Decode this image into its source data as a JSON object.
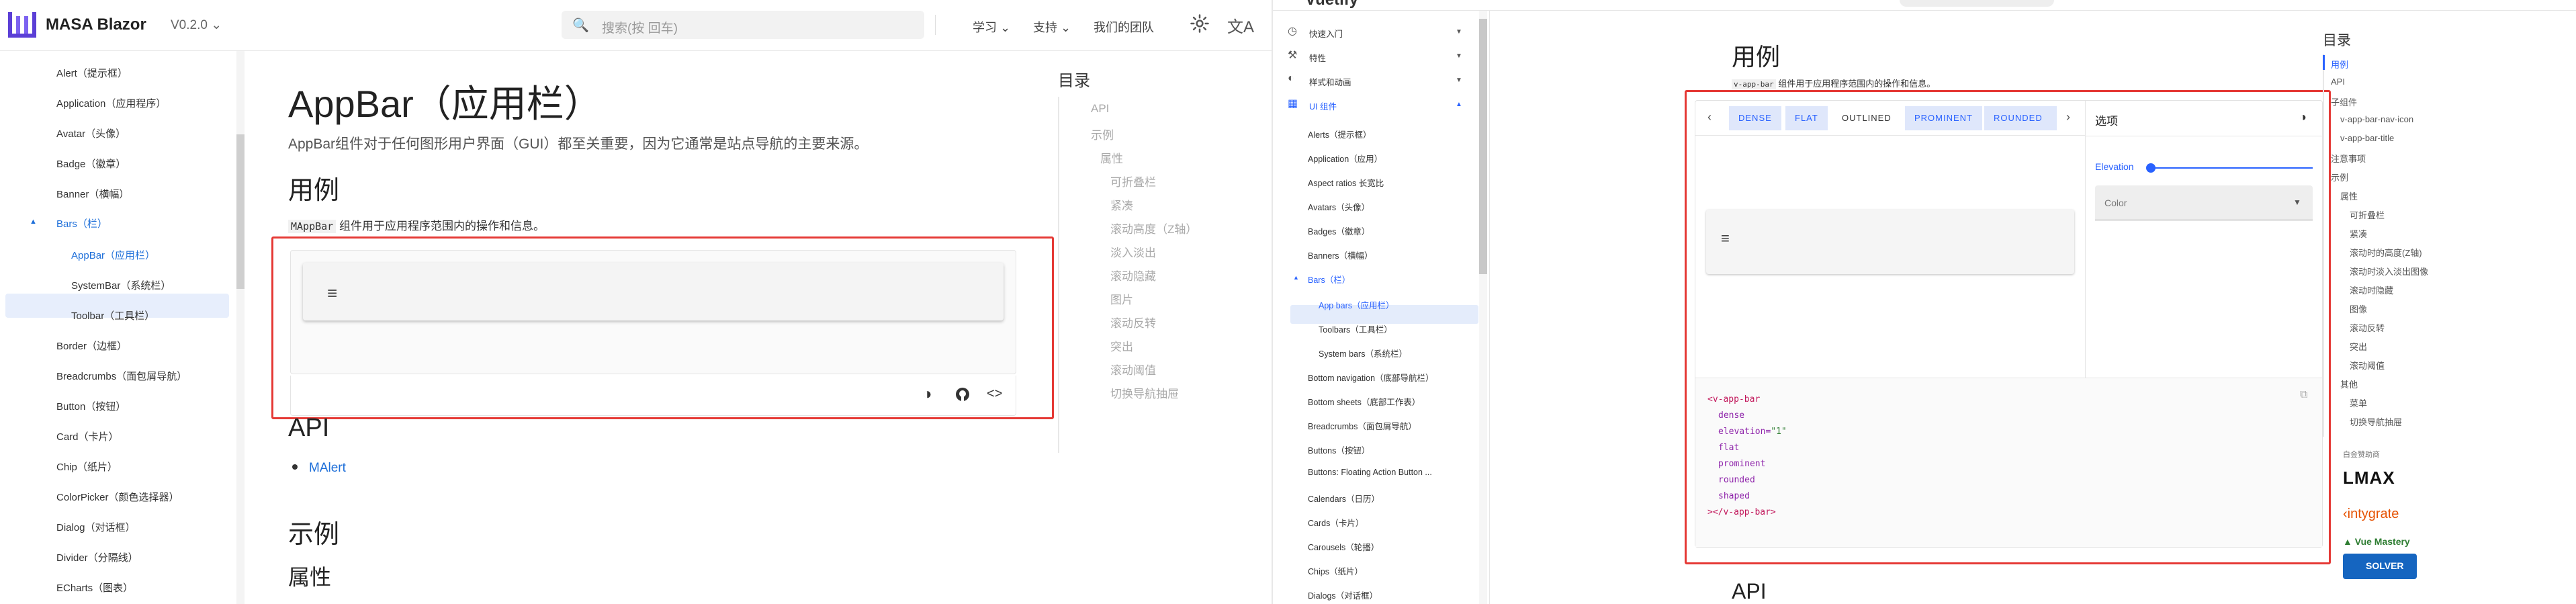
{
  "left": {
    "header": {
      "brand": "MASA Blazor",
      "version": "V0.2.0",
      "search_placeholder": "搜索(按 回车)",
      "nav": [
        "学习",
        "支持",
        "我们的团队"
      ]
    },
    "sidebar": {
      "items": [
        {
          "label": "Alert（提示框）",
          "indent": 1
        },
        {
          "label": "Application（应用程序）",
          "indent": 1
        },
        {
          "label": "Avatar（头像）",
          "indent": 1
        },
        {
          "label": "Badge（徽章）",
          "indent": 1
        },
        {
          "label": "Banner（横幅）",
          "indent": 1
        },
        {
          "label": "Bars（栏）",
          "indent": 1,
          "expanded": true
        },
        {
          "label": "AppBar（应用栏）",
          "indent": 2,
          "selected": true
        },
        {
          "label": "SystemBar（系统栏）",
          "indent": 2
        },
        {
          "label": "Toolbar（工具栏）",
          "indent": 2
        },
        {
          "label": "Border（边框）",
          "indent": 1
        },
        {
          "label": "Breadcrumbs（面包屑导航）",
          "indent": 1
        },
        {
          "label": "Button（按钮）",
          "indent": 1
        },
        {
          "label": "Card（卡片）",
          "indent": 1
        },
        {
          "label": "Chip（纸片）",
          "indent": 1
        },
        {
          "label": "ColorPicker（颜色选择器）",
          "indent": 1
        },
        {
          "label": "Dialog（对话框）",
          "indent": 1
        },
        {
          "label": "Divider（分隔线）",
          "indent": 1
        },
        {
          "label": "ECharts（图表）",
          "indent": 1
        }
      ]
    },
    "main": {
      "title": "AppBar（应用栏）",
      "subtitle": "AppBar组件对于任何图形用户界面（GUI）都至关重要，因为它通常是站点导航的主要来源。",
      "usage_heading": "用例",
      "usage_code": "MAppBar",
      "usage_text": " 组件用于应用程序范围内的操作和信息。",
      "api_heading": "API",
      "api_link": "MAlert",
      "examples_heading": "示例",
      "props_heading": "属性"
    },
    "toc": {
      "title": "目录",
      "items": [
        "API",
        "示例",
        "属性",
        "可折叠栏",
        "紧凑",
        "滚动高度（Z轴）",
        "淡入淡出",
        "滚动隐藏",
        "图片",
        "滚动反转",
        "突出",
        "滚动阈值",
        "切换导航抽屉"
      ]
    }
  },
  "right": {
    "header": {
      "brand": "Vuetify"
    },
    "sidebar": {
      "items": [
        {
          "label": "快速入门",
          "group": true,
          "icon": "clock-icon"
        },
        {
          "label": "特性",
          "group": true,
          "icon": "tools-icon"
        },
        {
          "label": "样式和动画",
          "group": true,
          "icon": "palette-icon"
        },
        {
          "label": "UI 组件",
          "group": true,
          "icon": "grid-icon",
          "expanded": true
        },
        {
          "label": "Alerts（提示框）"
        },
        {
          "label": "Application（应用）"
        },
        {
          "label": "Aspect ratios 长宽比"
        },
        {
          "label": "Avatars（头像）"
        },
        {
          "label": "Badges（徽章）"
        },
        {
          "label": "Banners（横幅）"
        },
        {
          "label": "Bars（栏）",
          "expanded": true
        },
        {
          "label": "App bars（应用栏）",
          "sub": true,
          "selected": true
        },
        {
          "label": "Toolbars（工具栏）",
          "sub": true
        },
        {
          "label": "System bars（系统栏）",
          "sub": true
        },
        {
          "label": "Bottom navigation（底部导航栏）"
        },
        {
          "label": "Bottom sheets（底部工作表）"
        },
        {
          "label": "Breadcrumbs（面包屑导航）"
        },
        {
          "label": "Buttons（按钮）"
        },
        {
          "label": "Buttons: Floating Action Button ..."
        },
        {
          "label": "Calendars（日历）"
        },
        {
          "label": "Cards（卡片）"
        },
        {
          "label": "Carousels（轮播）"
        },
        {
          "label": "Chips（纸片）"
        },
        {
          "label": "Dialogs（对话框）"
        }
      ]
    },
    "main": {
      "usage_heading": "用例",
      "usage_code": "v-app-bar",
      "usage_text": " 组件用于应用程序范围内的操作和信息。",
      "chips": [
        "DENSE",
        "FLAT",
        "OUTLINED",
        "PROMINENT",
        "ROUNDED"
      ],
      "options_title": "选项",
      "elevation_label": "Elevation",
      "color_label": "Color",
      "code_lines": [
        {
          "tag": "<v-app-bar"
        },
        {
          "attr": "dense"
        },
        {
          "attr": "elevation=",
          "val": "\"1\""
        },
        {
          "attr": "flat"
        },
        {
          "attr": "prominent"
        },
        {
          "attr": "rounded"
        },
        {
          "attr": "shaped"
        },
        {
          "tag": "></v-app-bar>"
        }
      ],
      "api_heading": "API"
    },
    "toc": {
      "title": "目录",
      "items": [
        {
          "label": "用例",
          "level": 0,
          "active": true
        },
        {
          "label": "API",
          "level": 0
        },
        {
          "label": "子组件",
          "level": 0
        },
        {
          "label": "v-app-bar-nav-icon",
          "level": 1
        },
        {
          "label": "v-app-bar-title",
          "level": 1
        },
        {
          "label": "注意事项",
          "level": 0
        },
        {
          "label": "示例",
          "level": 0
        },
        {
          "label": "属性",
          "level": 1
        },
        {
          "label": "可折叠栏",
          "level": 2
        },
        {
          "label": "紧凑",
          "level": 2
        },
        {
          "label": "滚动时的高度(Z轴)",
          "level": 2
        },
        {
          "label": "滚动时淡入淡出图像",
          "level": 2
        },
        {
          "label": "滚动时隐藏",
          "level": 2
        },
        {
          "label": "图像",
          "level": 2
        },
        {
          "label": "滚动反转",
          "level": 2
        },
        {
          "label": "突出",
          "level": 2
        },
        {
          "label": "滚动阈值",
          "level": 2
        },
        {
          "label": "其他",
          "level": 1
        },
        {
          "label": "菜单",
          "level": 2
        },
        {
          "label": "切换导航抽屉",
          "level": 2
        }
      ],
      "sponsor_label": "白金赞助商",
      "sponsors": [
        {
          "name": "LMAX",
          "color": "#111111"
        },
        {
          "name": "intygrate",
          "color": "#e65100"
        },
        {
          "name": "Vue Mastery",
          "color": "#2e7d32"
        },
        {
          "name": "SOLVER",
          "color": "#1565c0"
        }
      ]
    }
  },
  "colors": {
    "accent_left": "#1e6fd9",
    "accent_right": "#2962ff",
    "highlight": "#e53935"
  }
}
